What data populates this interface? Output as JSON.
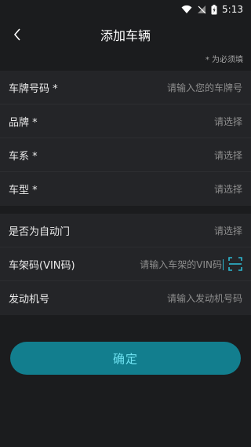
{
  "status_bar": {
    "time": "5:13"
  },
  "header": {
    "title": "添加车辆"
  },
  "required_hint": "* 为必须填",
  "section_basic": [
    {
      "label": "车牌号码 *",
      "value": "请输入您的车牌号"
    },
    {
      "label": "品牌 *",
      "value": "请选择"
    },
    {
      "label": "车系 *",
      "value": "请选择"
    },
    {
      "label": "车型 *",
      "value": "请选择"
    }
  ],
  "section_extra": {
    "auto_door": {
      "label": "是否为自动门",
      "value": "请选择"
    },
    "vin": {
      "label": "车架码(VIN码)",
      "placeholder": "请输入车架的VIN码"
    },
    "engine": {
      "label": "发动机号",
      "placeholder": "请输入发动机号码"
    }
  },
  "confirm_label": "确定",
  "colors": {
    "accent": "#127e8e",
    "button_text": "#6fe3f2",
    "scan_icon": "#2db7d0"
  }
}
